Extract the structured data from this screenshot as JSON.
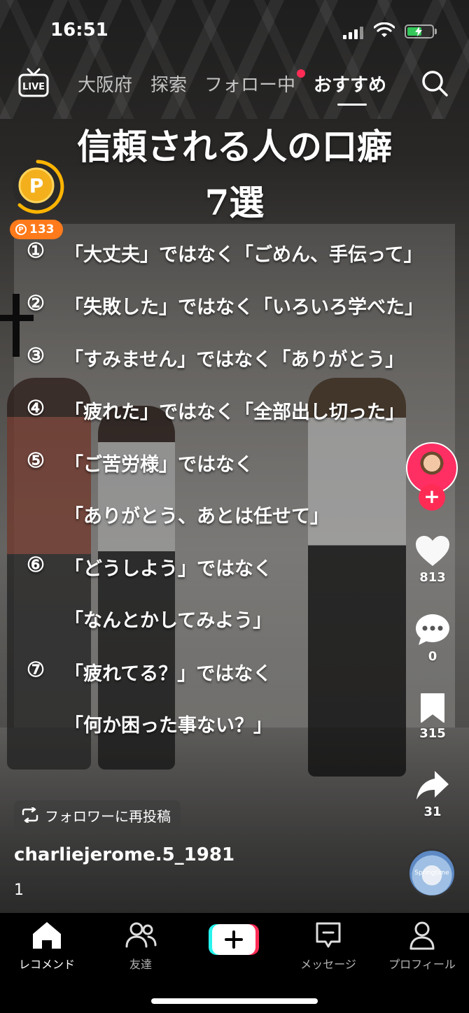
{
  "status_bar": {
    "time": "16:51",
    "battery_level": 0.6
  },
  "top_nav": {
    "live_label": "LIVE",
    "tabs": [
      {
        "label": "大阪府",
        "active": false
      },
      {
        "label": "探索",
        "active": false
      },
      {
        "label": "フォロー中",
        "active": false,
        "has_dot": true
      },
      {
        "label": "おすすめ",
        "active": true
      }
    ]
  },
  "coin": {
    "count": "133"
  },
  "video_text": {
    "title_line1": "信頼される人の口癖",
    "title_line2": "7選",
    "items": [
      {
        "num": "①",
        "lines": [
          "「大丈夫」ではなく「ごめん、手伝って」"
        ]
      },
      {
        "num": "②",
        "lines": [
          "「失敗した」ではなく「いろいろ学べた」"
        ]
      },
      {
        "num": "③",
        "lines": [
          "「すみません」ではなく「ありがとう」"
        ]
      },
      {
        "num": "④",
        "lines": [
          "「疲れた」ではなく「全部出し切った」"
        ]
      },
      {
        "num": "⑤",
        "lines": [
          "「ご苦労様」ではなく",
          "「ありがとう、あとは任せて」"
        ]
      },
      {
        "num": "⑥",
        "lines": [
          "「どうしよう」ではなく",
          "「なんとかしてみよう」"
        ]
      },
      {
        "num": "⑦",
        "lines": [
          "「疲れてる？」ではなく",
          "「何か困った事ない？」"
        ]
      }
    ]
  },
  "actions": {
    "likes": "813",
    "comments": "0",
    "bookmarks": "315",
    "shares": "31"
  },
  "post": {
    "repost_label": "フォロワーに再投稿",
    "username": "charliejerome.5_1981",
    "caption": "1",
    "music_disc_text": "Springtime"
  },
  "bottom_nav": {
    "home": "レコメンド",
    "friends": "友達",
    "inbox": "メッセージ",
    "profile": "プロフィール"
  },
  "colors": {
    "accent": "#fe2c55",
    "coin": "#ff7a1a",
    "battery": "#34c759"
  }
}
